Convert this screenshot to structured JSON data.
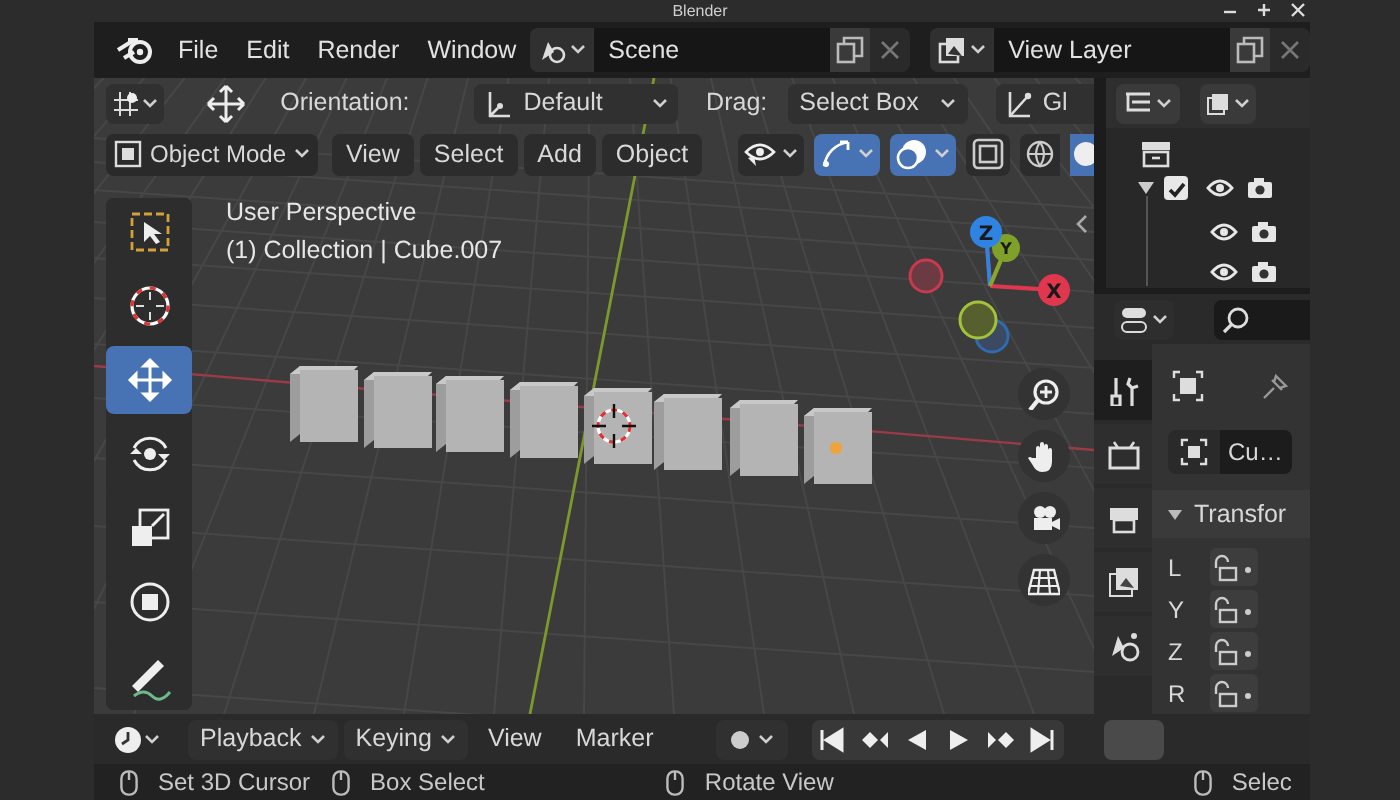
{
  "window": {
    "title": "Blender"
  },
  "menu": [
    "File",
    "Edit",
    "Render",
    "Window"
  ],
  "scene": {
    "value": "Scene"
  },
  "view_layer": {
    "value": "View Layer"
  },
  "tool_settings": {
    "orientation_label": "Orientation:",
    "orientation": "Default",
    "drag_label": "Drag:",
    "drag": "Select Box",
    "pivot": "Gl"
  },
  "viewport_header": {
    "mode": "Object Mode",
    "menus": [
      "View",
      "Select",
      "Add",
      "Object"
    ],
    "toggles": [
      {
        "kind": "visibility",
        "selected": false
      },
      {
        "kind": "gizmo",
        "selected": true
      },
      {
        "kind": "overlay",
        "selected": true
      },
      {
        "kind": "xray",
        "selected": false
      }
    ]
  },
  "viewport": {
    "perspective": "User Perspective",
    "context": "(1) Collection | Cube.007",
    "axes": [
      "Z",
      "Y",
      "X"
    ]
  },
  "toolbar": [
    {
      "kind": "select_box",
      "selected": false
    },
    {
      "kind": "cursor",
      "selected": false
    },
    {
      "kind": "move",
      "selected": true
    },
    {
      "kind": "rotate",
      "selected": false
    },
    {
      "kind": "scale",
      "selected": false
    },
    {
      "kind": "transform",
      "selected": false
    },
    {
      "kind": "annotate",
      "selected": false
    }
  ],
  "outliner": {
    "collection": {
      "expanded": true,
      "checked": true
    }
  },
  "properties": {
    "tabs": [
      {
        "kind": "tool",
        "selected": true
      },
      {
        "kind": "render",
        "selected": false
      },
      {
        "kind": "output",
        "selected": false
      },
      {
        "kind": "view_layer",
        "selected": false
      },
      {
        "kind": "scene",
        "selected": false
      }
    ],
    "object": "Cu…",
    "panel": {
      "title": "Transfor",
      "expanded": true
    },
    "rows": [
      "L",
      "Y",
      "Z",
      "R"
    ]
  },
  "timeline": {
    "menus": [
      {
        "label": "Playback",
        "kind": "dropdown"
      },
      {
        "label": "Keying",
        "kind": "dropdown"
      },
      {
        "label": "View",
        "kind": "menu"
      },
      {
        "label": "Marker",
        "kind": "menu"
      }
    ]
  },
  "status_bar": [
    "Set 3D Cursor",
    "Box Select",
    "Rotate View",
    "Selec"
  ]
}
